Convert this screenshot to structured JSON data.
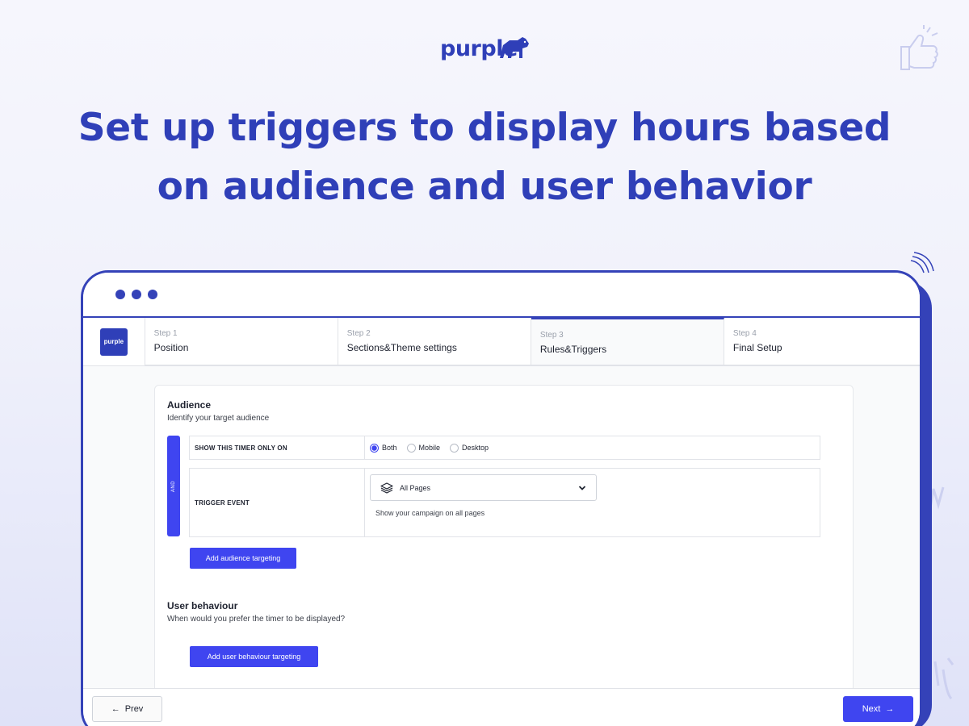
{
  "brand": {
    "name": "purple",
    "mini_name": "purple",
    "accent": "#3f45f0",
    "brand_color": "#2f3fb8"
  },
  "headline": {
    "line1": "Set up triggers to display hours based",
    "line2": "on audience and user behavior"
  },
  "steps": [
    {
      "number": "Step 1",
      "label": "Position",
      "active": false
    },
    {
      "number": "Step 2",
      "label": "Sections&Theme settings",
      "active": false
    },
    {
      "number": "Step 3",
      "label": "Rules&Triggers",
      "active": true
    },
    {
      "number": "Step 4",
      "label": "Final Setup",
      "active": false
    }
  ],
  "audience": {
    "title": "Audience",
    "subtitle": "Identify your target audience",
    "and_label": "AND",
    "device_rule": {
      "label": "SHOW THIS TIMER ONLY ON",
      "options": [
        "Both",
        "Mobile",
        "Desktop"
      ],
      "selected": "Both"
    },
    "trigger_rule": {
      "label": "TRIGGER EVENT",
      "selected": "All Pages",
      "helper": "Show your campaign on all pages"
    },
    "add_button": "Add audience targeting"
  },
  "behaviour": {
    "title": "User behaviour",
    "subtitle": "When would you prefer the timer to be displayed?",
    "add_button": "Add user behaviour targeting"
  },
  "footer": {
    "prev": "Prev",
    "next": "Next"
  },
  "icons": [
    "bear-logo-icon",
    "thumbs-up-icon",
    "layers-icon",
    "chevron-down-icon",
    "arrow-left-icon",
    "arrow-right-icon"
  ]
}
